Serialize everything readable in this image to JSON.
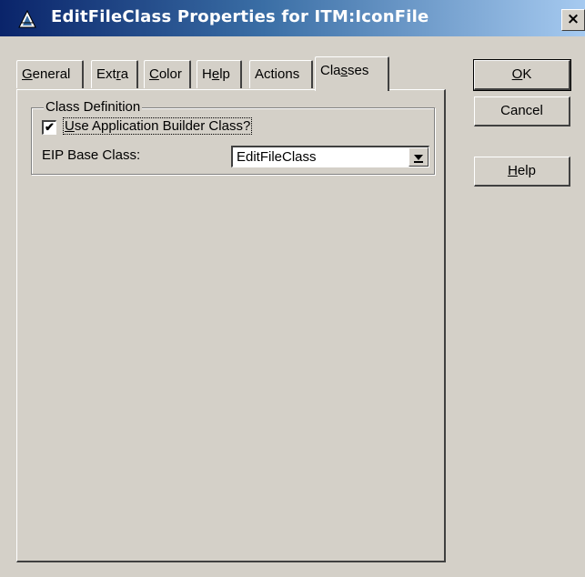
{
  "window": {
    "title": "EditFileClass Properties for ITM:IconFile",
    "close_glyph": "×"
  },
  "tabs": [
    {
      "pre": "",
      "ul": "G",
      "post": "eneral",
      "active": false
    },
    {
      "pre": "Ext",
      "ul": "r",
      "post": "a",
      "active": false
    },
    {
      "pre": "",
      "ul": "C",
      "post": "olor",
      "active": false
    },
    {
      "pre": "H",
      "ul": "e",
      "post": "lp",
      "active": false
    },
    {
      "pre": "Actions",
      "ul": "",
      "post": "",
      "active": false
    },
    {
      "pre": "Cla",
      "ul": "s",
      "post": "ses",
      "active": true
    }
  ],
  "class_definition": {
    "group_title": "Class Definition",
    "checkbox": {
      "label_pre": "",
      "label_ul": "U",
      "label_post": "se Application Builder Class?",
      "checked": true,
      "check_glyph": "✔"
    },
    "eip_base_class": {
      "label": "EIP Base Class:",
      "value": "EditFileClass"
    }
  },
  "buttons": {
    "ok": {
      "ul": "O",
      "post": "K"
    },
    "cancel": {
      "label": "Cancel"
    },
    "help": {
      "ul": "H",
      "post": "elp"
    }
  },
  "icons": {
    "app_icon": "clarion-triangle-icon",
    "dropdown": "chevron-down-icon"
  }
}
